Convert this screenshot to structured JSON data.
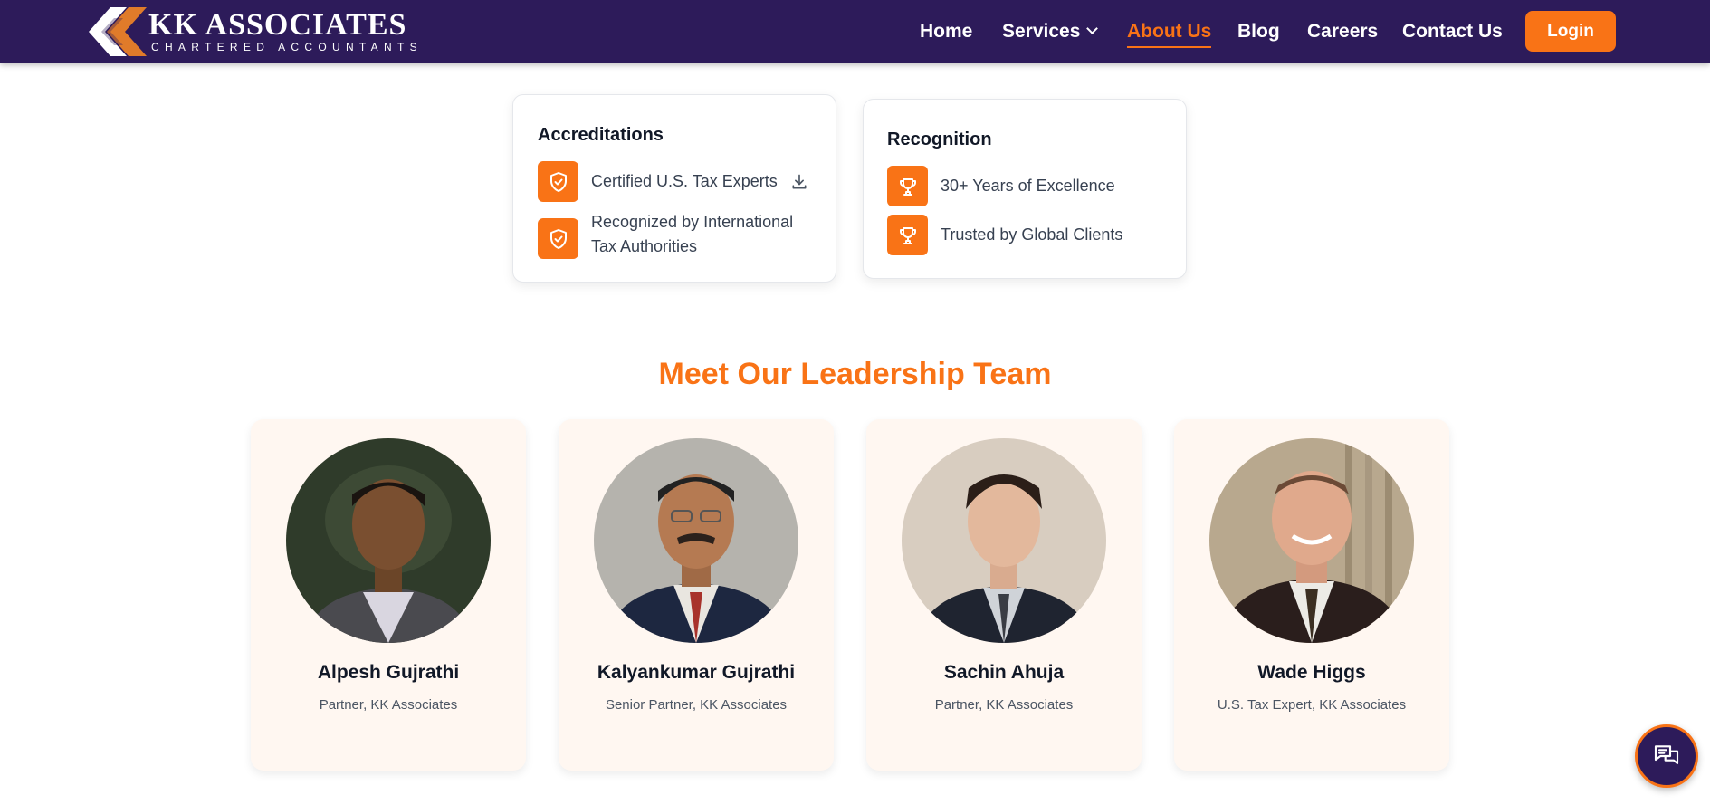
{
  "header": {
    "brand_name": "KK ASSOCIATES",
    "brand_tagline": "CHARTERED ACCOUNTANTS",
    "nav": [
      {
        "label": "Home"
      },
      {
        "label": "Services"
      },
      {
        "label": "About Us"
      },
      {
        "label": "Blog"
      },
      {
        "label": "Careers"
      },
      {
        "label": "Contact Us"
      }
    ],
    "login_label": "Login"
  },
  "accreditations": {
    "title": "Accreditations",
    "items": [
      {
        "text": "Certified U.S. Tax Experts",
        "icon": "shield-check-icon"
      },
      {
        "text": "Recognized by International Tax Authorities",
        "icon": "shield-check-icon"
      }
    ]
  },
  "recognition": {
    "title": "Recognition",
    "items": [
      {
        "text": "30+ Years of Excellence",
        "icon": "trophy-icon"
      },
      {
        "text": "Trusted by Global Clients",
        "icon": "trophy-icon"
      }
    ]
  },
  "team": {
    "title": "Meet Our Leadership Team",
    "members": [
      {
        "name": "Alpesh Gujrathi",
        "role": "Partner, KK Associates"
      },
      {
        "name": "Kalyankumar Gujrathi",
        "role": "Senior Partner, KK Associates"
      },
      {
        "name": "Sachin Ahuja",
        "role": "Partner, KK Associates"
      },
      {
        "name": "Wade Higgs",
        "role": "U.S. Tax Expert, KK Associates"
      }
    ]
  },
  "colors": {
    "nav_bg": "#2d1b5a",
    "accent": "#f97316",
    "card_bg": "#fff7f1"
  },
  "chat_icon": "chat-bubbles-icon"
}
